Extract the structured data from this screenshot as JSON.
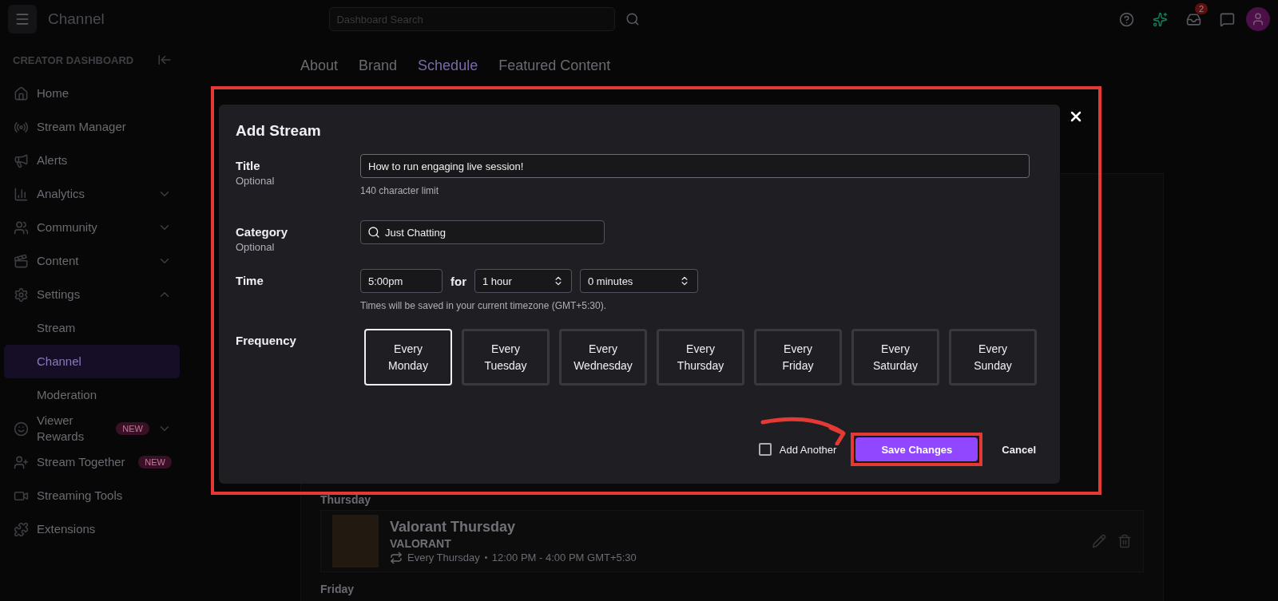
{
  "topbar": {
    "title": "Channel",
    "search": {
      "placeholder": "Dashboard Search"
    },
    "notification_count": "2"
  },
  "sidebar": {
    "heading": "CREATOR DASHBOARD",
    "items": [
      {
        "label": "Home",
        "selected": false
      },
      {
        "label": "Stream Manager",
        "selected": false
      },
      {
        "label": "Alerts",
        "selected": false
      },
      {
        "label": "Analytics",
        "selected": false,
        "expanded": false
      },
      {
        "label": "Community",
        "selected": false,
        "expanded": false
      },
      {
        "label": "Content",
        "selected": false,
        "expanded": false
      },
      {
        "label": "Settings",
        "selected": false,
        "expanded": true,
        "children": [
          {
            "label": "Stream",
            "selected": false
          },
          {
            "label": "Channel",
            "selected": true
          },
          {
            "label": "Moderation",
            "selected": false
          }
        ]
      },
      {
        "label": "Viewer Rewards",
        "selected": false,
        "badge": "NEW",
        "expanded": false
      },
      {
        "label": "Stream Together",
        "selected": false,
        "badge": "NEW"
      },
      {
        "label": "Streaming Tools",
        "selected": false
      },
      {
        "label": "Extensions",
        "selected": false
      }
    ]
  },
  "tabs": [
    {
      "label": "About",
      "selected": false
    },
    {
      "label": "Brand",
      "selected": false
    },
    {
      "label": "Schedule",
      "selected": true
    },
    {
      "label": "Featured Content",
      "selected": false
    }
  ],
  "schedule": {
    "days": [
      {
        "day": "Thursday",
        "streams": [
          {
            "title": "Valorant Thursday",
            "game": "VALORANT",
            "recurrence": "Every Thursday",
            "time": "12:00 PM - 4:00 PM GMT+5:30"
          }
        ]
      },
      {
        "day": "Friday"
      }
    ]
  },
  "dialog": {
    "title": "Add Stream",
    "title_field": {
      "label": "Title",
      "sublabel": "Optional",
      "value": "How to run engaging live session!",
      "hint": "140 character limit"
    },
    "category_field": {
      "label": "Category",
      "sublabel": "Optional",
      "value": "Just Chatting"
    },
    "time_field": {
      "label": "Time",
      "start": "5:00pm",
      "joiner": "for",
      "hours": "1 hour",
      "minutes": "0 minutes",
      "hint": "Times will be saved in your current timezone (GMT+5:30)."
    },
    "frequency": {
      "label": "Frequency",
      "options": [
        {
          "label": "Every Monday",
          "selected": true
        },
        {
          "label": "Every Tuesday",
          "selected": false
        },
        {
          "label": "Every Wednesday",
          "selected": false
        },
        {
          "label": "Every Thursday",
          "selected": false
        },
        {
          "label": "Every Friday",
          "selected": false
        },
        {
          "label": "Every Saturday",
          "selected": false
        },
        {
          "label": "Every Sunday",
          "selected": false
        }
      ]
    },
    "add_another": {
      "label": "Add Another",
      "checked": false
    },
    "save": "Save Changes",
    "cancel": "Cancel"
  }
}
